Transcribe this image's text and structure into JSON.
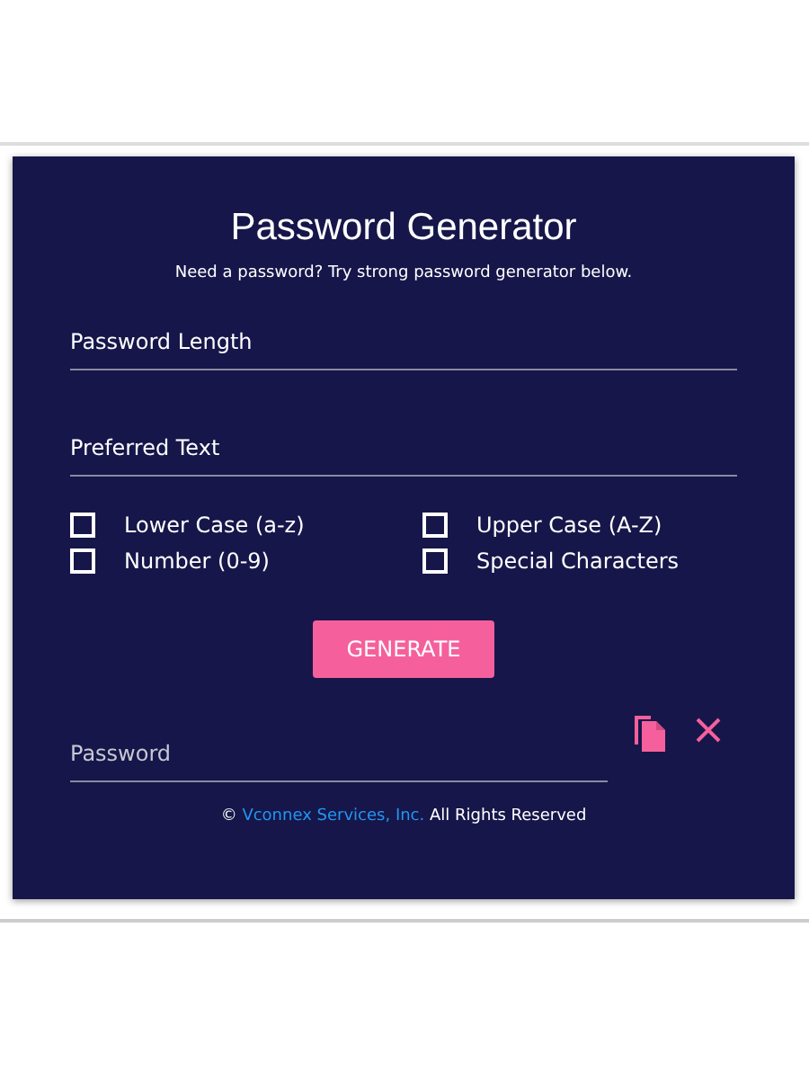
{
  "title": "Password Generator",
  "subtitle": "Need a password? Try strong password generator below.",
  "fields": [
    {
      "placeholder": "Password Length"
    },
    {
      "placeholder": "Preferred Text"
    }
  ],
  "options": [
    {
      "label": "Lower Case (a-z)",
      "checked": false
    },
    {
      "label": "Upper Case (A-Z)",
      "checked": false
    },
    {
      "label": "Number (0-9)",
      "checked": false
    },
    {
      "label": "Special Characters",
      "checked": false
    }
  ],
  "generate_button": "GENERATE",
  "output": {
    "placeholder": "Password"
  },
  "footer": {
    "prefix": "©",
    "link": "Vconnex Services, Inc.",
    "suffix": "All Rights Reserved"
  }
}
